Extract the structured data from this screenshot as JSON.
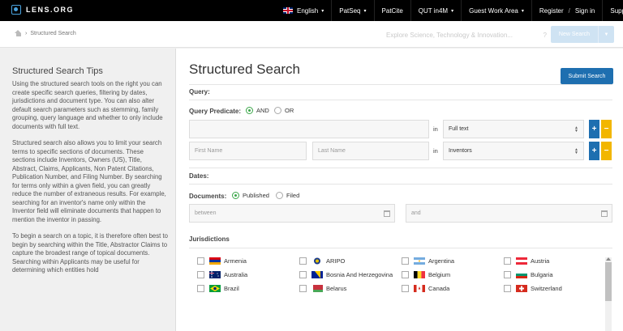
{
  "topbar": {
    "logo": "LENS.ORG",
    "nav": [
      {
        "label": "English",
        "has_caret": true,
        "has_flag": true
      },
      {
        "label": "PatSeq",
        "has_caret": true
      },
      {
        "label": "PatCite",
        "has_caret": false
      },
      {
        "label": "QUT in4M",
        "has_caret": true
      },
      {
        "label": "Guest Work Area",
        "has_caret": true
      }
    ],
    "register": "Register",
    "signin": "Sign in",
    "support": "Support"
  },
  "breadcrumb": {
    "current": "Structured Search"
  },
  "search": {
    "placeholder": "Explore Science, Technology & Innovation...",
    "help": "?"
  },
  "new_search": {
    "label": "New Search"
  },
  "tips": {
    "title": "Structured Search Tips",
    "paragraphs": [
      "Using the structured search tools on the right you can create specific search queries, filtering by dates, jurisdictions and document type. You can also alter default search parameters such as stemming, family grouping, query language and whether to only include documents with full text.",
      "Structured search also allows you to limit your search terms to specific sections of documents. These sections include Inventors, Owners (US), Title, Abstract, Claims, Applicants, Non Patent Citations, Publication Number, and Filing Number. By searching for terms only within a given field, you can greatly reduce the number of extraneous results. For example, searching for an inventor's name only within the Inventor field will eliminate documents that happen to mention the inventor in passing.",
      "To begin a search on a topic, it is therefore often best to begin by searching within the Title, Abstractor Claims to capture the broadest range of topical documents. Searching within Applicants may be useful for determining which entities hold"
    ]
  },
  "main": {
    "title": "Structured Search",
    "submit": "Submit Search",
    "query_label": "Query:",
    "predicate_label": "Query Predicate:",
    "predicate_and": "AND",
    "predicate_or": "OR",
    "in_label": "in",
    "row1_field": "Full text",
    "first_name_placeholder": "First Name",
    "last_name_placeholder": "Last Name",
    "row2_field": "Inventors",
    "plus": "+",
    "minus": "−",
    "dates_label": "Dates:",
    "documents_label": "Documents:",
    "doc_published": "Published",
    "doc_filed": "Filed",
    "between_placeholder": "between",
    "and_placeholder": "and",
    "jurisdictions_label": "Jurisdictions"
  },
  "jurisdictions": [
    [
      "Armenia",
      "ARIPO",
      "Argentina",
      "Austria"
    ],
    [
      "Australia",
      "Bosnia And Herzegovina",
      "Belgium",
      "Bulgaria"
    ],
    [
      "Brazil",
      "Belarus",
      "Canada",
      "Switzerland"
    ]
  ],
  "colors": {
    "accent": "#1e6fb0",
    "minus": "#f2b600",
    "radio_on": "#3aa648"
  }
}
